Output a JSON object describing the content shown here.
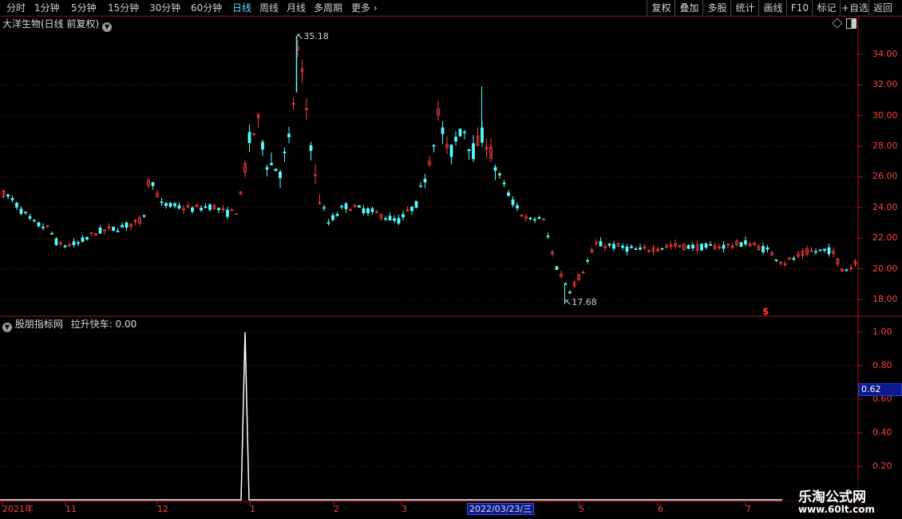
{
  "toolbar": {
    "periods": [
      {
        "label": "分时",
        "x": 8,
        "active": false
      },
      {
        "label": "1分钟",
        "x": 43,
        "active": false
      },
      {
        "label": "5分钟",
        "x": 89,
        "active": false
      },
      {
        "label": "15分钟",
        "x": 135,
        "active": false
      },
      {
        "label": "30分钟",
        "x": 187,
        "active": false
      },
      {
        "label": "60分钟",
        "x": 239,
        "active": false
      },
      {
        "label": "日线",
        "x": 291,
        "active": true
      },
      {
        "label": "周线",
        "x": 325,
        "active": false
      },
      {
        "label": "月线",
        "x": 359,
        "active": false
      },
      {
        "label": "多周期",
        "x": 393,
        "active": false
      },
      {
        "label": "更多",
        "x": 440,
        "active": false
      }
    ],
    "right_buttons": [
      "复权",
      "叠加",
      "多股",
      "统计",
      "画线",
      "F10",
      "标记",
      "+自选",
      "返回"
    ]
  },
  "main_chart": {
    "title": "大洋生物(日线 前复权)",
    "high_label": "35.18",
    "low_label": "17.68",
    "y_ticks": [
      "34.00",
      "32.00",
      "30.00",
      "28.00",
      "26.00",
      "24.00",
      "22.00",
      "20.00",
      "18.00"
    ],
    "marker": "$"
  },
  "indicator": {
    "source": "股朋指标网",
    "name_value": "拉升快车: 0.00",
    "y_ticks": [
      "1.00",
      "0.80",
      "0.60",
      "0.40",
      "0.20"
    ],
    "current_tag": "0.62"
  },
  "date_axis": {
    "labels": [
      "2021年",
      "11",
      "12",
      "1",
      "2",
      "3",
      "5",
      "6",
      "7"
    ],
    "cursor_date": "2022/03/23/三"
  },
  "watermark": {
    "line1": "乐淘公式网",
    "line2": "www.60lt.com"
  },
  "colors": {
    "up": "#ff3c3c",
    "down": "#54fcfc",
    "grid": "#7a1010",
    "axis_text": "#ff4040"
  }
}
